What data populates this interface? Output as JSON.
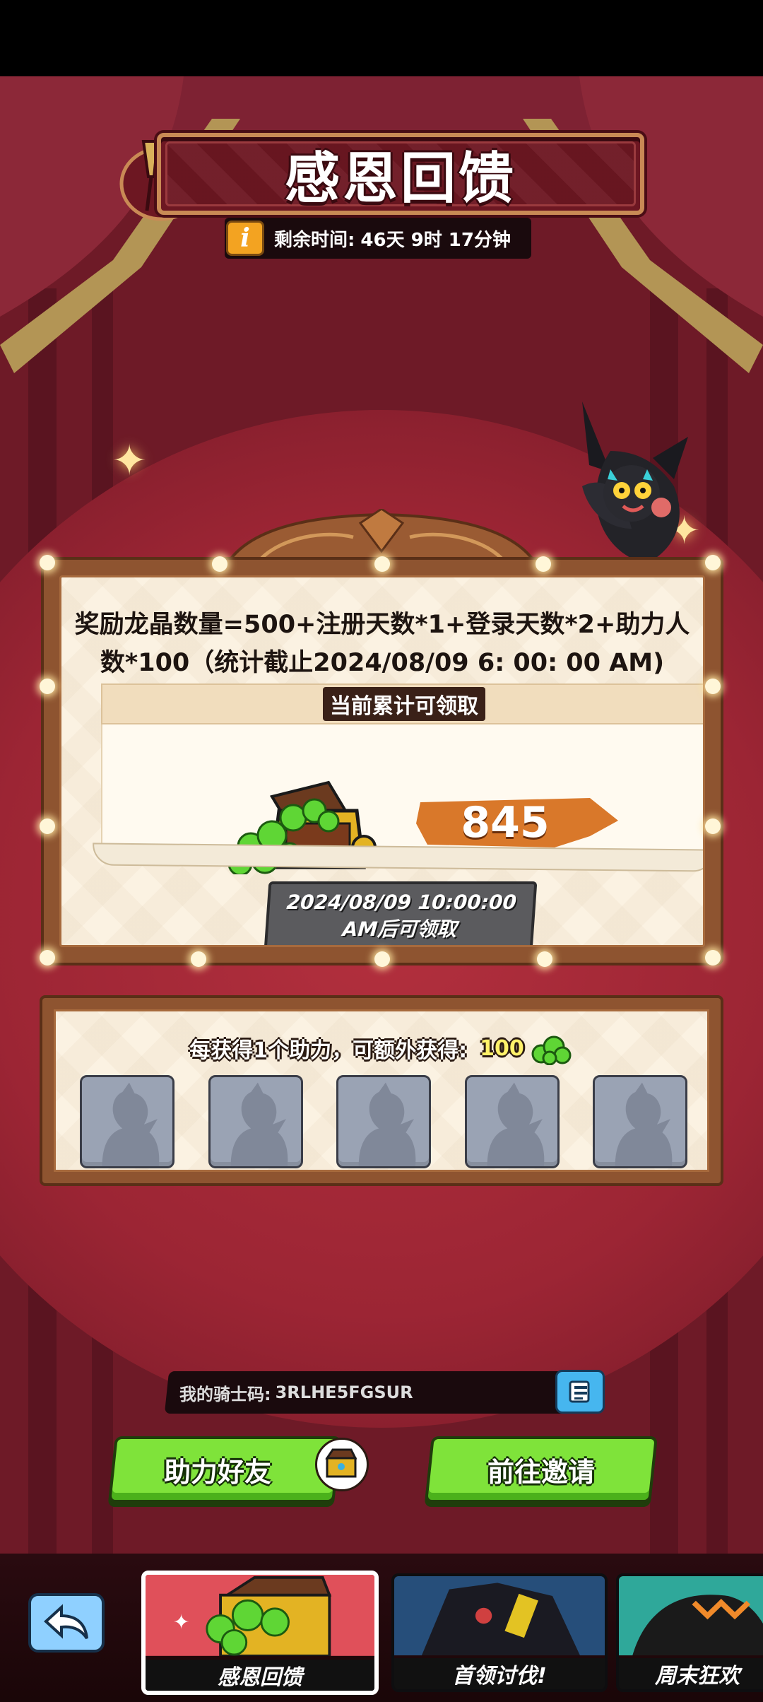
{
  "event": {
    "title": "感恩回馈",
    "timer_label": "剩余时间:",
    "timer_value": "46天 9时 17分钟",
    "timer_icon": "info-icon"
  },
  "reward": {
    "formula": "奖励龙晶数量=500+注册天数*1+登录天数*2+助力人数*100（统计截止2024/08/09 6: 00: 00 AM)",
    "claim_header": "当前累计可领取",
    "amount": "845",
    "unlock_text": "2024/08/09 10:00:00 AM后可领取"
  },
  "helpers": {
    "line": "每获得1个助力，可额外获得:",
    "bonus": "100",
    "slot_count": 5
  },
  "knight_code": {
    "label": "我的骑士码:",
    "value": "3RLHE5FGSUR",
    "copy_icon": "copy-icon"
  },
  "actions": {
    "help_friend": "助力好友",
    "go_invite": "前往邀请"
  },
  "tabs": [
    {
      "label": "感恩回馈",
      "active": true
    },
    {
      "label": "首领讨伐!",
      "active": false
    },
    {
      "label": "周末狂欢",
      "active": false
    }
  ],
  "colors": {
    "accent_green": "#7fe33a",
    "amount_orange": "#d9782a",
    "background_red": "#7a1e2c"
  }
}
